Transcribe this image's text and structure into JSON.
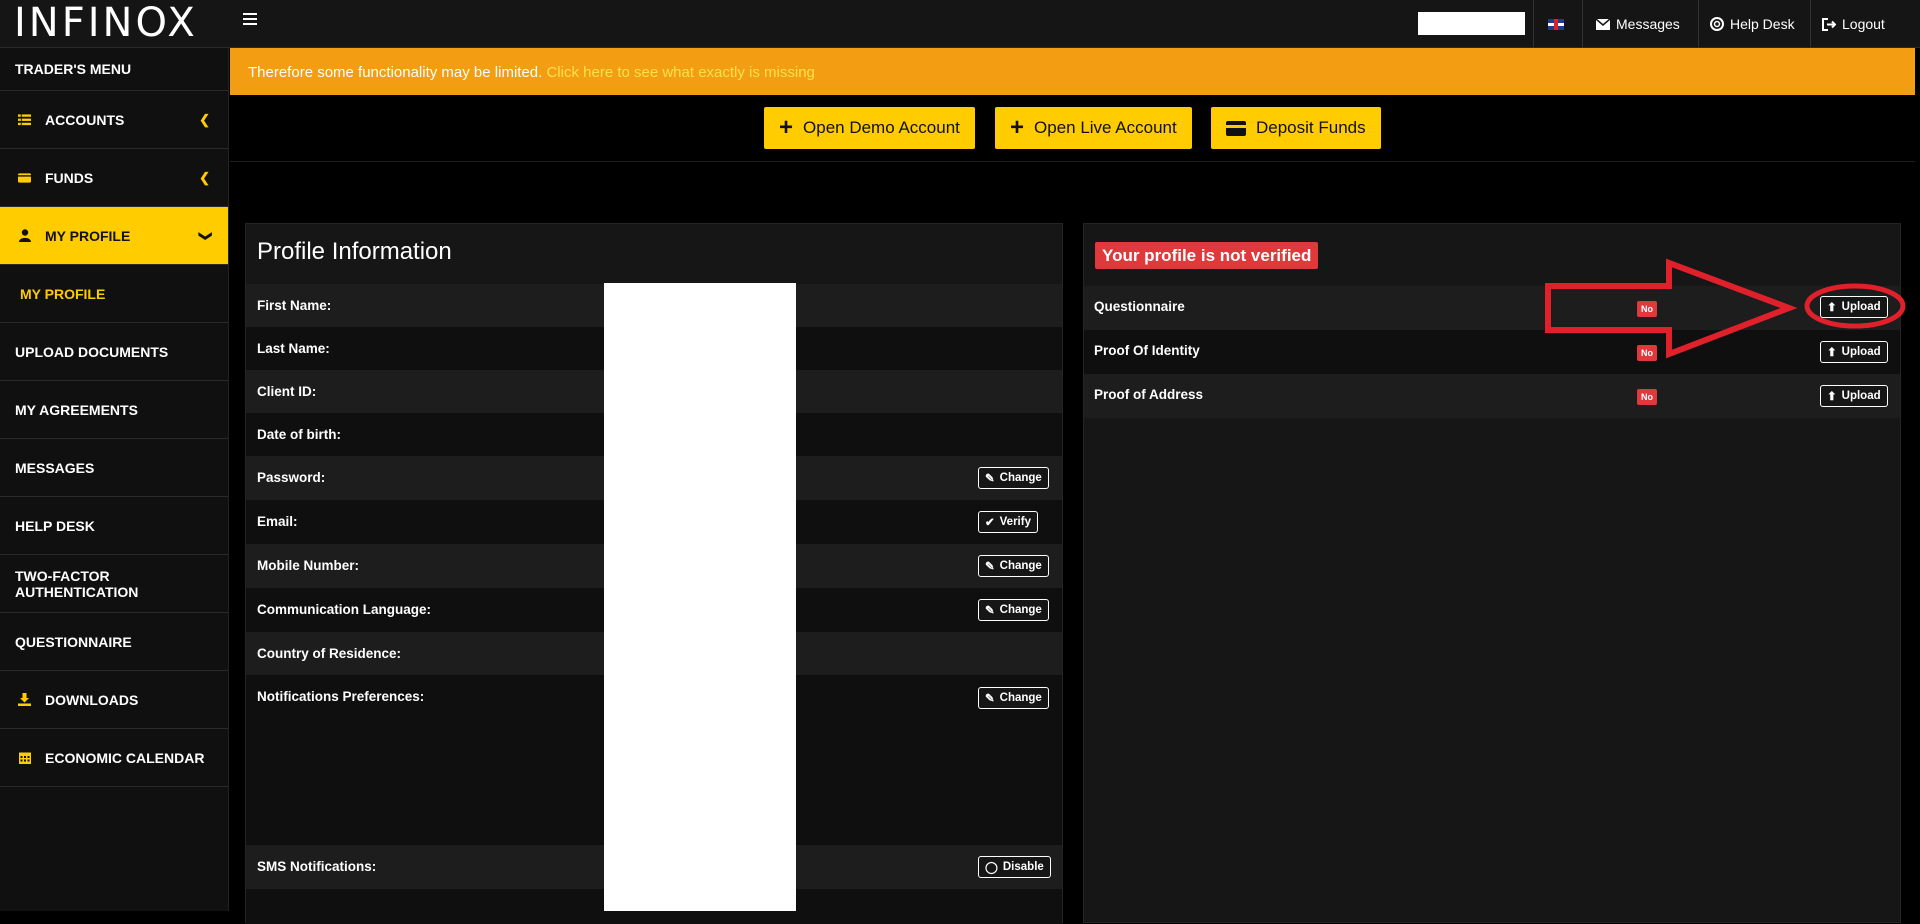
{
  "header": {
    "logo": "INFINOX",
    "messages": "Messages",
    "help_desk": "Help Desk",
    "logout": "Logout"
  },
  "sidebar": {
    "heading": "TRADER'S MENU",
    "accounts": "ACCOUNTS",
    "funds": "FUNDS",
    "my_profile": "MY PROFILE",
    "sub_my_profile": "MY PROFILE",
    "upload_documents": "UPLOAD DOCUMENTS",
    "my_agreements": "MY AGREEMENTS",
    "messages": "MESSAGES",
    "help_desk": "HELP DESK",
    "two_factor": "TWO-FACTOR AUTHENTICATION",
    "questionnaire": "QUESTIONNAIRE",
    "downloads": "DOWNLOADS",
    "economic_calendar": "ECONOMIC CALENDAR"
  },
  "banner": {
    "line2_text": "Therefore some functionality may be limited.",
    "line2_link": "Click here to see what exactly is missing"
  },
  "actions": {
    "open_demo": "Open Demo Account",
    "open_live": "Open Live Account",
    "deposit": "Deposit Funds"
  },
  "profile": {
    "title": "Profile Information",
    "first_name": "First Name:",
    "last_name": "Last Name:",
    "client_id": "Client ID:",
    "dob": "Date of birth:",
    "password": "Password:",
    "email": "Email:",
    "mobile": "Mobile Number:",
    "comm_lang": "Communication Language:",
    "country": "Country of Residence:",
    "notifications": "Notifications Preferences:",
    "sms": "SMS Notifications:",
    "change": "Change",
    "verify": "Verify",
    "disable": "Disable"
  },
  "verification": {
    "status": "Your profile is not verified",
    "questionnaire": "Questionnaire",
    "proof_identity": "Proof Of Identity",
    "proof_address": "Proof of Address",
    "no": "No",
    "upload": "Upload"
  },
  "colors": {
    "accent": "#ffcc00",
    "banner": "#f29d12",
    "danger": "#e0393c",
    "annotation": "#e0202a"
  }
}
